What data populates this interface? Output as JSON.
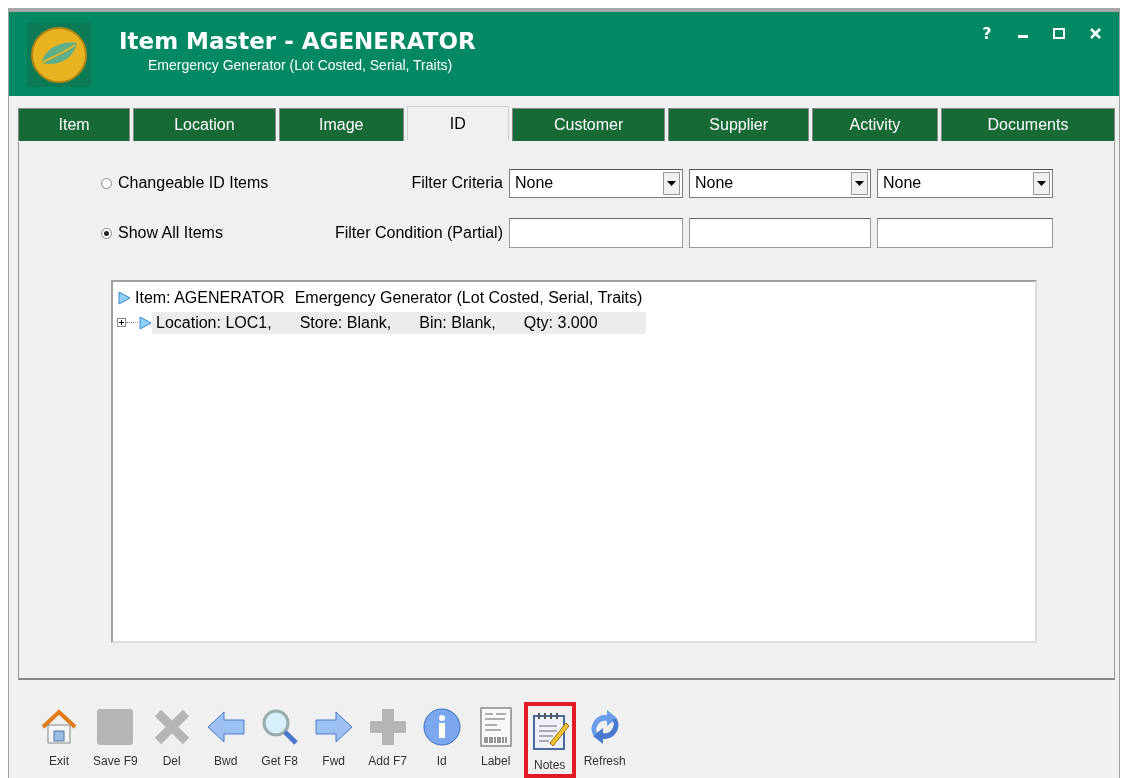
{
  "window": {
    "title": "Item Master - AGENERATOR",
    "subtitle": "Emergency Generator (Lot Costed, Serial, Traits)",
    "controls": [
      {
        "kind": "help",
        "label": "?"
      },
      {
        "kind": "minimize"
      },
      {
        "kind": "maximize"
      },
      {
        "kind": "close"
      }
    ]
  },
  "tabs": [
    {
      "label": "Item",
      "selected": false
    },
    {
      "label": "Location",
      "selected": false
    },
    {
      "label": "Image",
      "selected": false
    },
    {
      "label": "ID",
      "selected": true
    },
    {
      "label": "Customer",
      "selected": false
    },
    {
      "label": "Supplier",
      "selected": false
    },
    {
      "label": "Activity",
      "selected": false
    },
    {
      "label": "Documents",
      "selected": false
    }
  ],
  "mode_options": [
    {
      "label": "Changeable ID Items",
      "selected": false
    },
    {
      "label": "Show All Items",
      "selected": true
    }
  ],
  "filter_criteria": {
    "label": "Filter Criteria",
    "dropdowns": [
      "None",
      "None",
      "None"
    ]
  },
  "filter_condition": {
    "label": "Filter Condition (Partial)"
  },
  "tree": [
    {
      "columns": [
        "Item: AGENERATOR",
        "Emergency Generator (Lot Costed, Serial, Traits)"
      ],
      "selected": false,
      "children": [
        {
          "columns": [
            "Location: LOC1,",
            "Store: Blank,",
            "Bin: Blank,",
            "Qty: 3.000"
          ],
          "selected": true,
          "expanded": false
        }
      ]
    }
  ],
  "toolbar": [
    {
      "kind": "home",
      "label": "Exit",
      "disabled": false,
      "highlighted": false
    },
    {
      "kind": "save",
      "label": "Save F9",
      "disabled": true,
      "highlighted": false
    },
    {
      "kind": "delete",
      "label": "Del",
      "disabled": true,
      "highlighted": false
    },
    {
      "kind": "back",
      "label": "Bwd",
      "disabled": false,
      "highlighted": false
    },
    {
      "kind": "search",
      "label": "Get F8",
      "disabled": false,
      "highlighted": false
    },
    {
      "kind": "forward",
      "label": "Fwd",
      "disabled": false,
      "highlighted": false
    },
    {
      "kind": "add",
      "label": "Add F7",
      "disabled": true,
      "highlighted": false
    },
    {
      "kind": "info",
      "label": "Id",
      "disabled": false,
      "highlighted": false
    },
    {
      "kind": "label",
      "label": "Label",
      "disabled": false,
      "highlighted": false
    },
    {
      "kind": "notes",
      "label": "Notes",
      "disabled": false,
      "highlighted": true
    },
    {
      "kind": "refresh",
      "label": "Refresh",
      "disabled": false,
      "highlighted": false
    }
  ]
}
